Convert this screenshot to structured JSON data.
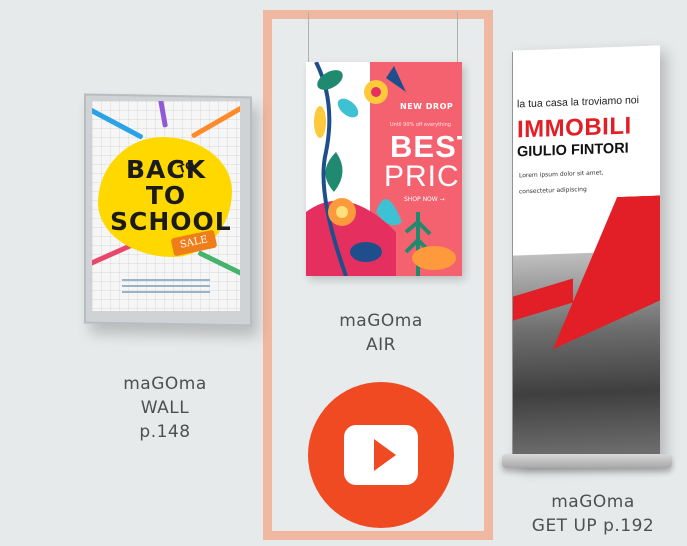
{
  "products": {
    "wall": {
      "name": "maGOma",
      "model": "WALL",
      "page": "p.148",
      "poster": {
        "headline": "BACK TO SCHOOL",
        "to": "TO",
        "tag": "SALE"
      }
    },
    "air": {
      "name": "maGOma",
      "model": "AIR",
      "poster": {
        "kicker": "NEW DROP",
        "sub": "Until 90% off everything",
        "line1": "BEST",
        "line2": "PRICE",
        "cta": "SHOP NOW →"
      }
    },
    "getup": {
      "name": "maGOma",
      "model_page": "GET UP p.192",
      "banner": {
        "tagline": "la tua casa la troviamo noi",
        "brand": "IMMOBILI",
        "owner": "GIULIO FINTORI",
        "lorem1": "Lorem ipsum dolor sit amet,",
        "lorem2": "consectetur adipiscing"
      }
    }
  },
  "video": {
    "icon": "play-icon"
  },
  "colors": {
    "background": "#e7eaeb",
    "highlight": "#f1b8a1",
    "play": "#f04a23",
    "brand_red": "#e21e26",
    "air_coral": "#f4626f",
    "school_yellow": "#ffd800"
  }
}
